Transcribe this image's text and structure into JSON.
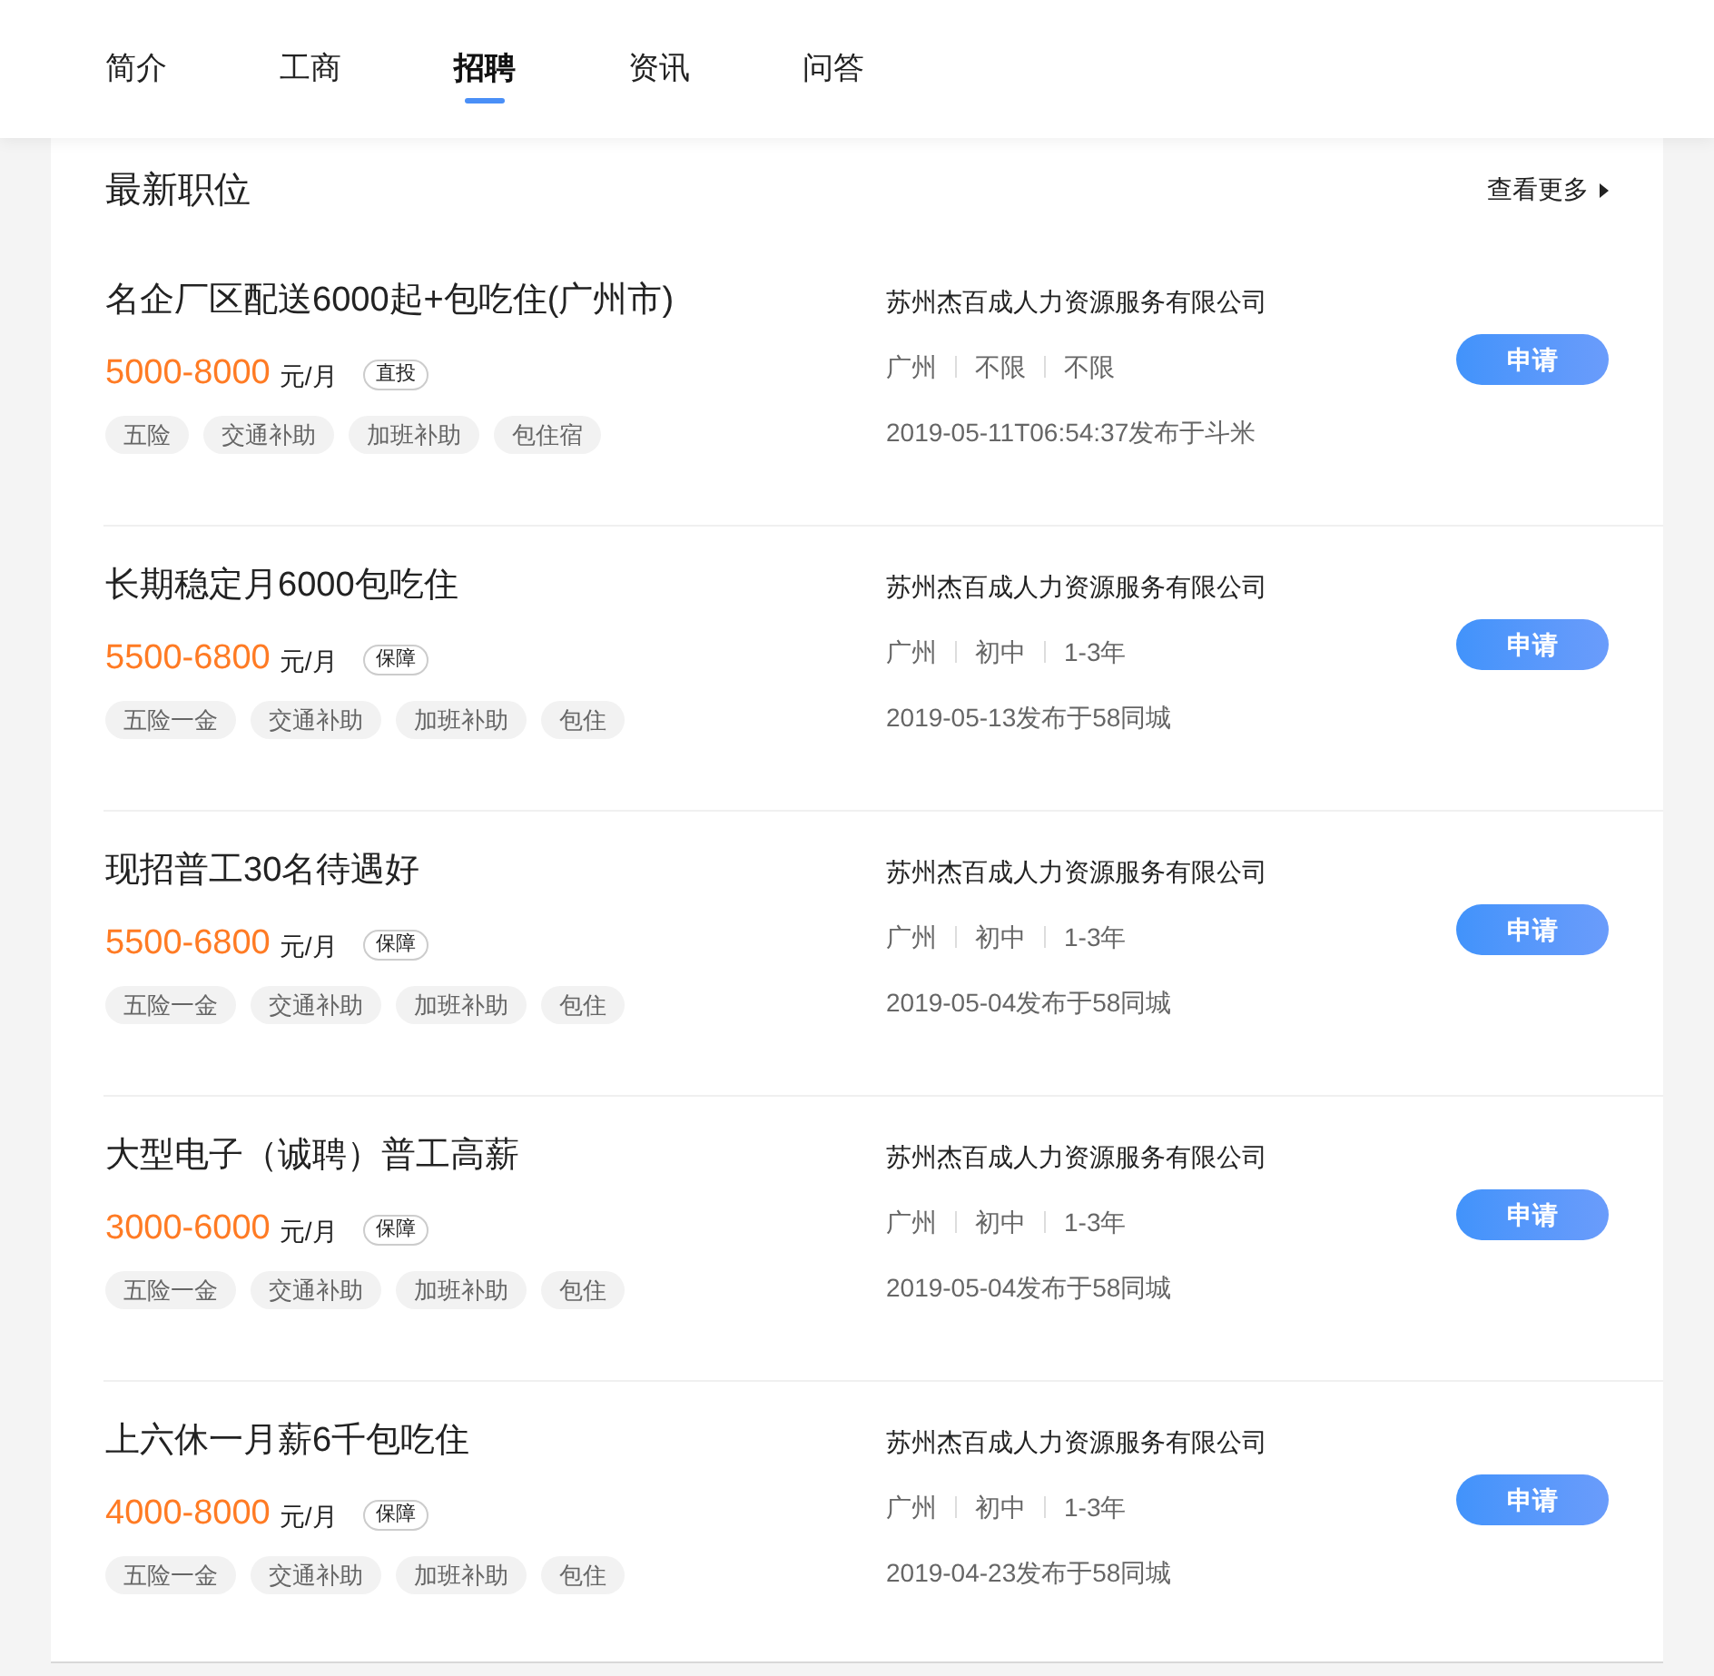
{
  "tabs": [
    {
      "label": "简介",
      "selected": false
    },
    {
      "label": "工商",
      "selected": false
    },
    {
      "label": "招聘",
      "selected": true
    },
    {
      "label": "资讯",
      "selected": false
    },
    {
      "label": "问答",
      "selected": false
    }
  ],
  "section": {
    "title": "最新职位",
    "more_link": "查看更多"
  },
  "jobs": [
    {
      "title": "名企厂区配送6000起+包吃住(广州市)",
      "salary": "5000-8000",
      "unit": "元/月",
      "badge": "直投",
      "benefits": [
        "五险",
        "交通补助",
        "加班补助",
        "包住宿"
      ],
      "company": "苏州杰百成人力资源服务有限公司",
      "requirements": [
        "广州",
        "不限",
        "不限"
      ],
      "posted": "2019-05-11T06:54:37发布于斗米",
      "apply": "申请"
    },
    {
      "title": "长期稳定月6000包吃住",
      "salary": "5500-6800",
      "unit": "元/月",
      "badge": "保障",
      "benefits": [
        "五险一金",
        "交通补助",
        "加班补助",
        "包住"
      ],
      "company": "苏州杰百成人力资源服务有限公司",
      "requirements": [
        "广州",
        "初中",
        "1-3年"
      ],
      "posted": "2019-05-13发布于58同城",
      "apply": "申请"
    },
    {
      "title": "现招普工30名待遇好",
      "salary": "5500-6800",
      "unit": "元/月",
      "badge": "保障",
      "benefits": [
        "五险一金",
        "交通补助",
        "加班补助",
        "包住"
      ],
      "company": "苏州杰百成人力资源服务有限公司",
      "requirements": [
        "广州",
        "初中",
        "1-3年"
      ],
      "posted": "2019-05-04发布于58同城",
      "apply": "申请"
    },
    {
      "title": "大型电子（诚聘）普工高薪",
      "salary": "3000-6000",
      "unit": "元/月",
      "badge": "保障",
      "benefits": [
        "五险一金",
        "交通补助",
        "加班补助",
        "包住"
      ],
      "company": "苏州杰百成人力资源服务有限公司",
      "requirements": [
        "广州",
        "初中",
        "1-3年"
      ],
      "posted": "2019-05-04发布于58同城",
      "apply": "申请"
    },
    {
      "title": "上六休一月薪6千包吃住",
      "salary": "4000-8000",
      "unit": "元/月",
      "badge": "保障",
      "benefits": [
        "五险一金",
        "交通补助",
        "加班补助",
        "包住"
      ],
      "company": "苏州杰百成人力资源服务有限公司",
      "requirements": [
        "广州",
        "初中",
        "1-3年"
      ],
      "posted": "2019-04-23发布于58同城",
      "apply": "申请"
    }
  ]
}
